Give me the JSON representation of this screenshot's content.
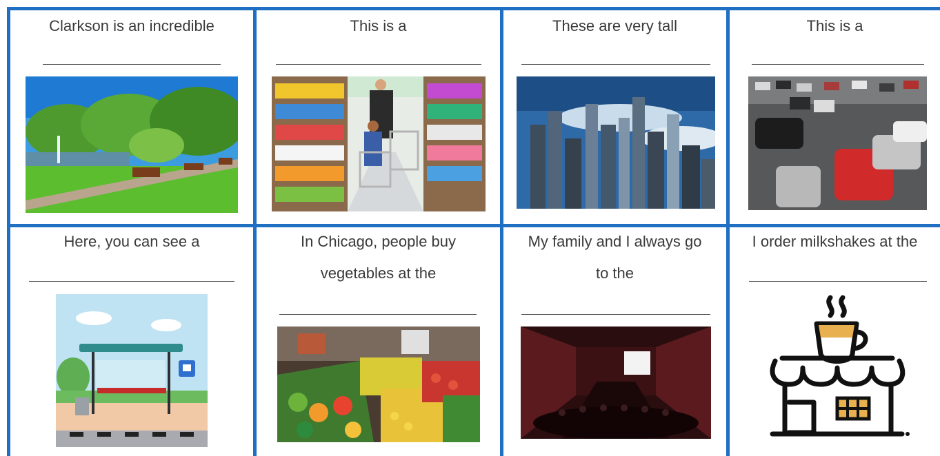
{
  "worksheet": {
    "cards": [
      {
        "prompt_lines": [
          "Clarkson is an incredible"
        ],
        "picture": "park-photo"
      },
      {
        "prompt_lines": [
          "This is a"
        ],
        "picture": "supermarket-photo"
      },
      {
        "prompt_lines": [
          "These are very tall"
        ],
        "picture": "skyscrapers-photo"
      },
      {
        "prompt_lines": [
          "This is a"
        ],
        "picture": "parking-lot-photo"
      },
      {
        "prompt_lines": [
          "Here, you can see a"
        ],
        "picture": "bus-stop-icon"
      },
      {
        "prompt_lines": [
          "In Chicago, people buy",
          "vegetables at the"
        ],
        "picture": "market-photo"
      },
      {
        "prompt_lines": [
          "My family and I always go",
          "to the"
        ],
        "picture": "movie-theater-photo"
      },
      {
        "prompt_lines": [
          "I order milkshakes at the"
        ],
        "picture": "cafe-icon"
      }
    ]
  },
  "colors": {
    "border": "#1f6fc3",
    "text": "#3a3a3a"
  }
}
